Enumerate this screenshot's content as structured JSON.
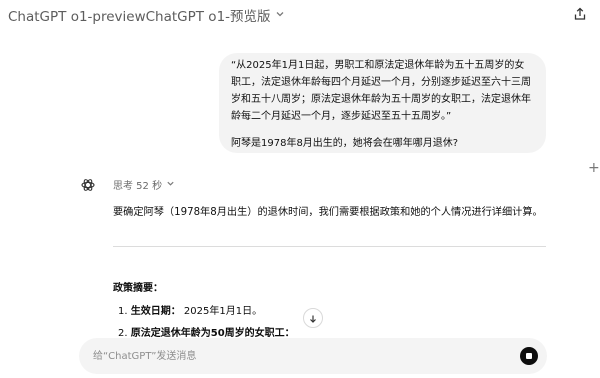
{
  "header": {
    "title": "ChatGPT o1-previewChatGPT o1-预览版",
    "chevron_icon": "chevron-down-icon",
    "share_icon": "share-icon"
  },
  "conversation": {
    "user_message": {
      "paragraph": "“从2025年1月1日起，男职工和原法定退休年龄为五十五周岁的女职工，法定退休年龄每四个月延迟一个月，分别逐步延迟至六十三周岁和五十八周岁；原法定退休年龄为五十周岁的女职工，法定退休年龄每二个月延迟一个月，逐步延迟至五十五周岁。”",
      "question": "阿琴是1978年8月出生的，她将会在哪年哪月退休?"
    },
    "assistant": {
      "avatar_icon": "chatgpt-logo-icon",
      "thinking_label": "思考 52 秒",
      "intro": "要确定阿琴（1978年8月出生）的退休时间，我们需要根据政策和她的个人情况进行详细计算。",
      "summary_title": "政策摘要：",
      "list": [
        {
          "num": "1.",
          "label": "生效日期：",
          "value": " 2025年1月1日。"
        },
        {
          "num": "2.",
          "label": "原法定退休年龄为50周岁的女职工：",
          "value": ""
        }
      ]
    }
  },
  "composer": {
    "placeholder": "给“ChatGPT”发送消息",
    "value": ""
  },
  "colors": {
    "bubble": "#f3f3f3",
    "composer": "#f4f4f4",
    "stop_button": "#0d0d0d"
  }
}
